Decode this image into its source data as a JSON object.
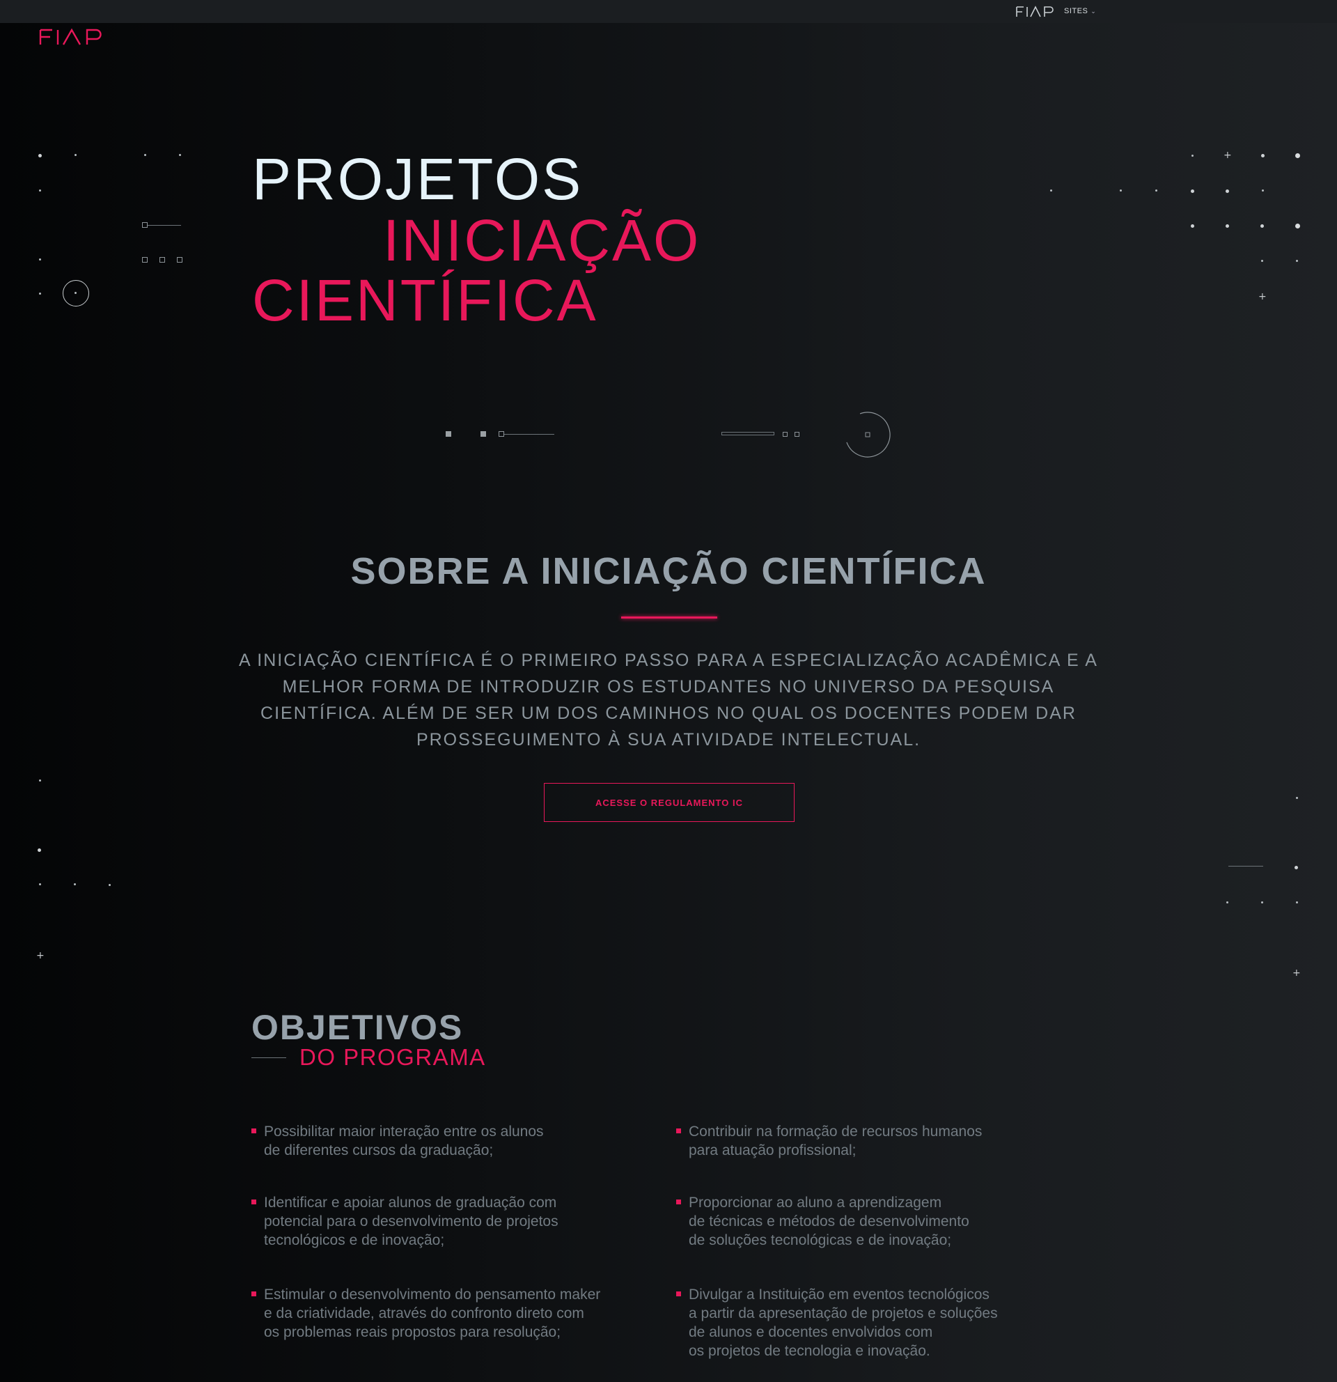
{
  "topbar": {
    "logo_text": "FIAP",
    "sites_label": "SITES"
  },
  "brand": {
    "logo_text": "FIAP",
    "accent_color": "#e8185a"
  },
  "hero": {
    "line1": "PROJETOS",
    "line2": "INICIAÇÃO",
    "line3": "CIENTÍFICA"
  },
  "about": {
    "title": "SOBRE A INICIAÇÃO CIENTÍFICA",
    "text": "A INICIAÇÃO CIENTÍFICA É O PRIMEIRO PASSO PARA A ESPECIALIZAÇÃO ACADÊMICA E A MELHOR FORMA DE INTRODUZIR OS ESTUDANTES NO UNIVERSO DA PESQUISA CIENTÍFICA. ALÉM DE SER UM DOS CAMINHOS NO QUAL OS DOCENTES PODEM DAR PROSSEGUIMENTO À SUA ATIVIDADE INTELECTUAL.",
    "cta_label": "ACESSE O REGULAMENTO IC"
  },
  "objectives": {
    "title": "OBJETIVOS",
    "subtitle": "DO PROGRAMA",
    "items": [
      "Possibilitar maior interação entre os alunos\nde diferentes cursos da graduação;",
      "Contribuir na formação de recursos humanos\npara atuação profissional;",
      "Identificar e apoiar alunos de graduação com\npotencial para o desenvolvimento de projetos\ntecnológicos e de inovação;",
      "Proporcionar ao aluno a aprendizagem\nde técnicas e métodos de desenvolvimento\nde soluções tecnológicas e de inovação;",
      "Estimular o desenvolvimento do pensamento maker\ne da criatividade, através do confronto direto com\nos problemas reais propostos para resolução;",
      "Divulgar a Instituição em eventos tecnológicos\na partir da apresentação de projetos e soluções\nde alunos e docentes envolvidos com\nos projetos de tecnologia e inovação."
    ]
  }
}
